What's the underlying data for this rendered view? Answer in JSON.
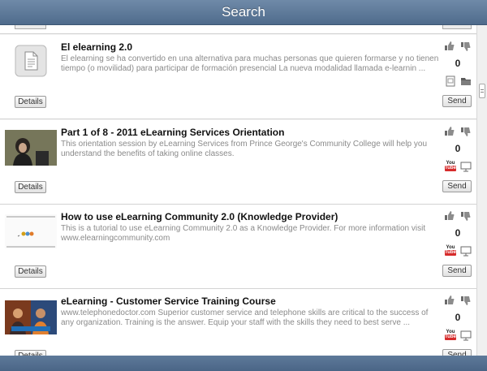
{
  "header": {
    "title": "Search"
  },
  "items": [
    {
      "title": "El elearning 2.0",
      "description": "El elearning se ha convertido en una alternativa para muchas personas que quieren formarse y no tienen tiempo (o movilidad) para participar de formación presencial La nueva modalidad llamada e-learnin ...",
      "votes": "0",
      "thumbnail": "document-icon",
      "source_icons": [
        "document-icon",
        "folder-icon"
      ]
    },
    {
      "title": "Part 1 of 8 - 2011 eLearning Services Orientation",
      "description": "This orientation session by eLearning Services from Prince George's Community College will help you understand the benefits of taking online classes.",
      "votes": "0",
      "thumbnail": "video-presenter-thumbnail",
      "source_icons": [
        "youtube-icon",
        "presentation-icon"
      ]
    },
    {
      "title": "How to use eLearning Community 2.0 (Knowledge Provider)",
      "description": "This is a tutorial to use eLearning Community 2.0 as a Knowledge Provider. For more information visit www.elearningcommunity.com",
      "votes": "0",
      "thumbnail": "slide-thumbnail",
      "source_icons": [
        "youtube-icon",
        "presentation-icon"
      ]
    },
    {
      "title": "eLearning - Customer Service Training Course",
      "description": "www.telephonedoctor.com Superior customer service and telephone skills are critical to the success of any organization. Training is the answer. Equip your staff with the skills they need to best serve ...",
      "votes": "0",
      "thumbnail": "training-video-thumbnail",
      "source_icons": [
        "youtube-icon",
        "presentation-icon"
      ]
    }
  ],
  "labels": {
    "details": "Details",
    "send": "Send",
    "youtube_you": "You",
    "youtube_tube": "Tube"
  },
  "colors": {
    "header": "#5a7697",
    "youtube": "#d62b2b"
  }
}
